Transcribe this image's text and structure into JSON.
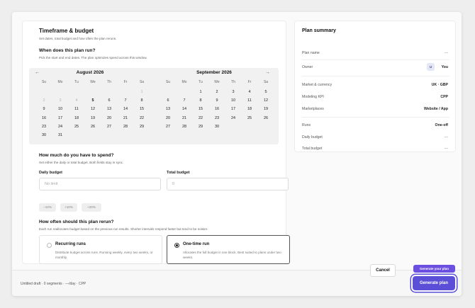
{
  "timeframe": {
    "title": "Timeframe & budget",
    "subtitle": "Set dates, total budget and how often the plan reruns.",
    "question": "When does this plan run?",
    "hint": "Pick the start and end dates. The plan optimizes spend across this window."
  },
  "calendar": {
    "weekdays": [
      "Su",
      "Mo",
      "Tu",
      "We",
      "Th",
      "Fr",
      "Sa"
    ],
    "prev_icon": "arrow-left-icon",
    "next_icon": "arrow-right-icon",
    "months": [
      {
        "name": "August 2026",
        "rows": [
          [
            "",
            "",
            "",
            "",
            "",
            "",
            "1"
          ],
          [
            "2",
            "3",
            "4",
            "5",
            "6",
            "7",
            "8"
          ],
          [
            "9",
            "10",
            "11",
            "12",
            "13",
            "14",
            "15"
          ],
          [
            "16",
            "17",
            "18",
            "19",
            "20",
            "21",
            "22"
          ],
          [
            "23",
            "24",
            "25",
            "26",
            "27",
            "28",
            "29"
          ],
          [
            "30",
            "31",
            "",
            "",
            "",
            "",
            ""
          ]
        ]
      },
      {
        "name": "September 2026",
        "rows": [
          [
            "",
            "",
            "1",
            "2",
            "3",
            "4",
            "5"
          ],
          [
            "6",
            "7",
            "8",
            "9",
            "10",
            "11",
            "12"
          ],
          [
            "13",
            "14",
            "15",
            "16",
            "17",
            "18",
            "19"
          ],
          [
            "20",
            "21",
            "22",
            "23",
            "24",
            "25",
            "26"
          ],
          [
            "27",
            "28",
            "29",
            "30",
            "",
            "",
            ""
          ]
        ]
      }
    ]
  },
  "spend": {
    "question": "How much do you have to spend?",
    "hint": "Set either the daily or total budget. Both fields stay in sync.",
    "daily_label": "Daily budget",
    "daily_placeholder": "No limit",
    "total_label": "Total budget",
    "total_placeholder": "0",
    "chips": [
      "−10%",
      "+10%",
      "+20%"
    ]
  },
  "rerun": {
    "question": "How often should this plan rerun?",
    "hint": "Each run reallocates budget based on the previous run results. Shorter intervals respond faster but tend to be noisier.",
    "options": [
      {
        "title": "Recurring runs",
        "desc": "Distribute budget across runs. Running weekly, every two weeks, or monthly.",
        "selected": false
      },
      {
        "title": "One-time run",
        "desc": "Allocates the full budget in one block. Best suited to plans under two weeks.",
        "selected": true
      }
    ]
  },
  "summary": {
    "title": "Plan summary",
    "plan_name": {
      "label": "Plan name",
      "value": "—"
    },
    "owner": {
      "label": "Owner",
      "avatar": "U",
      "value": "You"
    },
    "market": {
      "label": "Market & currency",
      "value": "UK · GBP"
    },
    "kpi": {
      "label": "Modeling KPI",
      "value": "CPP"
    },
    "marketplaces": {
      "label": "Marketplaces",
      "value": "Website / App"
    },
    "runs": {
      "label": "Runs",
      "value": "One-off"
    },
    "daily": {
      "label": "Daily budget",
      "value": "—"
    },
    "total": {
      "label": "Total budget",
      "value": "—"
    }
  },
  "footer": {
    "status": "Untitled draft · 0 segments · —/day · CPP",
    "cancel": "Cancel",
    "generate": "Generate plan",
    "tooltip": "Generate your plan"
  }
}
